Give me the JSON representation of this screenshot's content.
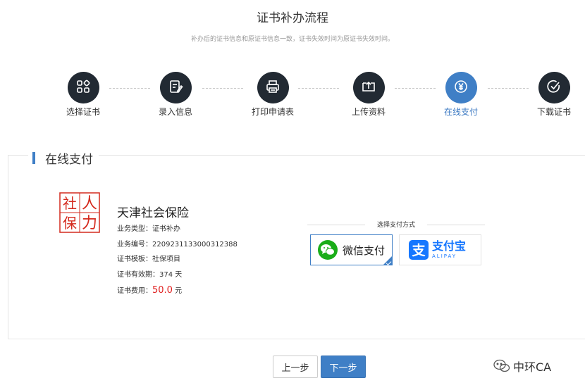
{
  "page": {
    "title": "证书补办流程",
    "subtitle": "补办后的证书信息和原证书信息一致，证书失效时间为原证书失效时间。"
  },
  "steps": [
    {
      "label": "选择证书",
      "icon": "grid-icon",
      "active": false
    },
    {
      "label": "录入信息",
      "icon": "edit-icon",
      "active": false
    },
    {
      "label": "打印申请表",
      "icon": "printer-icon",
      "active": false
    },
    {
      "label": "上传资料",
      "icon": "upload-icon",
      "active": false
    },
    {
      "label": "在线支付",
      "icon": "yen-icon",
      "active": true
    },
    {
      "label": "下载证书",
      "icon": "check-circle-icon",
      "active": false
    }
  ],
  "panel": {
    "title": "在线支付"
  },
  "seal": {
    "chars": [
      "人",
      "社",
      "力",
      "保"
    ],
    "color": "#d42a1e"
  },
  "order": {
    "company": "天津社会保险",
    "business_type_label": "业务类型：",
    "business_type": "证书补办",
    "business_no_label": "业务编号：",
    "business_no": "2209231133000312388",
    "template_label": "证书模板：",
    "template": "社保项目",
    "validity_label": "证书有效期：",
    "validity": "374 天",
    "fee_label": "证书费用：",
    "fee_value": "50.0",
    "fee_unit": " 元"
  },
  "payment": {
    "header": "选择支付方式",
    "wechat_label": "微信支付",
    "alipay_label": "支付宝",
    "alipay_sub": "ALIPAY",
    "selected": "wechat",
    "wechat_color": "#1aad19",
    "alipay_color": "#1677ff"
  },
  "buttons": {
    "prev": "上一步",
    "next": "下一步"
  },
  "watermark": {
    "text": "中环CA"
  },
  "colors": {
    "accent": "#3f7fc6",
    "step_dark": "#222a33",
    "fee_red": "#e02020"
  }
}
